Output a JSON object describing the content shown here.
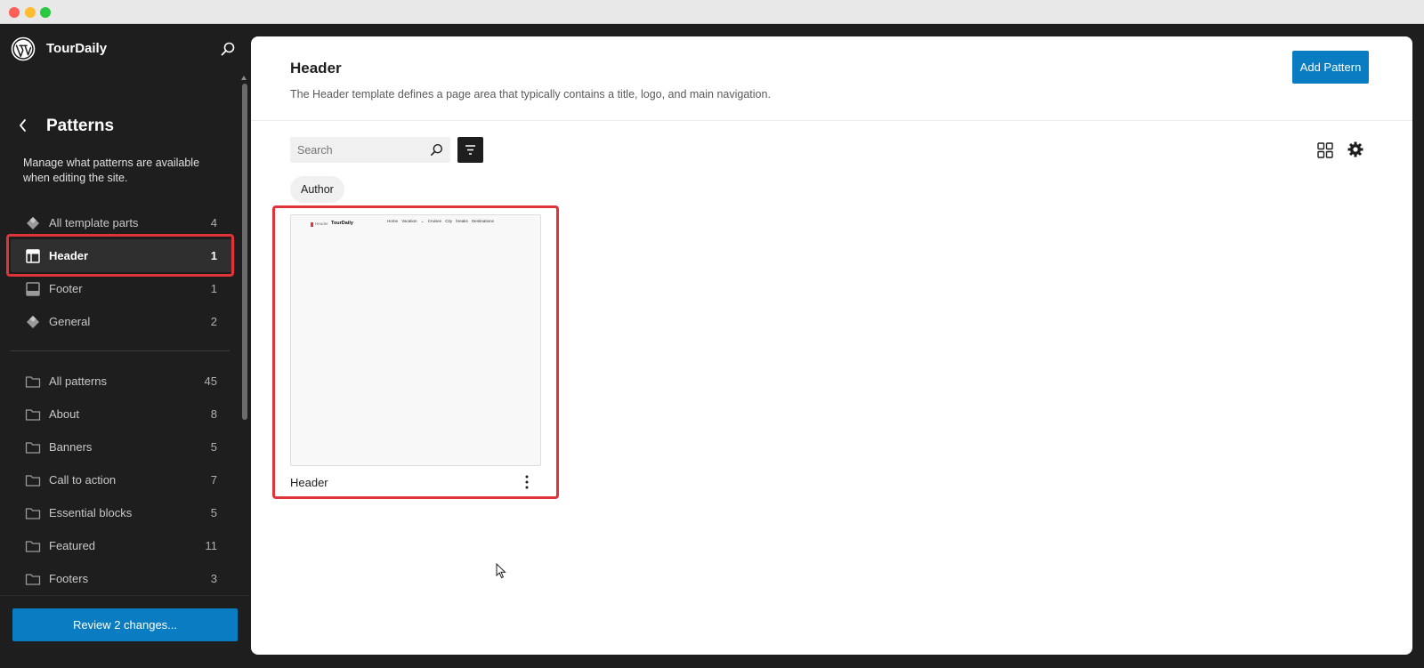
{
  "site": {
    "name": "TourDaily"
  },
  "sidebar": {
    "title": "Patterns",
    "description": "Manage what patterns are available when editing the site.",
    "template_parts": [
      {
        "label": "All template parts",
        "count": "4",
        "icon": "symbol-filled-icon"
      },
      {
        "label": "Header",
        "count": "1",
        "icon": "header-layout-icon",
        "active": true
      },
      {
        "label": "Footer",
        "count": "1",
        "icon": "footer-layout-icon"
      },
      {
        "label": "General",
        "count": "2",
        "icon": "symbol-filled-icon"
      }
    ],
    "categories": [
      {
        "label": "All patterns",
        "count": "45",
        "icon": "folder-icon"
      },
      {
        "label": "About",
        "count": "8",
        "icon": "folder-icon"
      },
      {
        "label": "Banners",
        "count": "5",
        "icon": "folder-icon"
      },
      {
        "label": "Call to action",
        "count": "7",
        "icon": "folder-icon"
      },
      {
        "label": "Essential blocks",
        "count": "5",
        "icon": "folder-icon"
      },
      {
        "label": "Featured",
        "count": "11",
        "icon": "folder-icon"
      },
      {
        "label": "Footers",
        "count": "3",
        "icon": "folder-icon"
      }
    ],
    "review_button": "Review 2 changes..."
  },
  "main": {
    "title": "Header",
    "description": "The Header template defines a page area that typically contains a title, logo, and main navigation.",
    "add_button": "Add Pattern",
    "search": {
      "placeholder": "Search",
      "value": ""
    },
    "filter_chip": "Author",
    "cards": [
      {
        "title": "Header",
        "preview": {
          "logo_text": "Header",
          "site_title": "TourDaily",
          "nav": [
            "Home",
            "Vacation ⌄",
            "Cruises",
            "City breaks",
            "Destinations"
          ]
        }
      }
    ]
  },
  "colors": {
    "accent": "#0a7cc2",
    "sidebar_bg": "#1e1e1e",
    "highlight": "#e0333a"
  }
}
